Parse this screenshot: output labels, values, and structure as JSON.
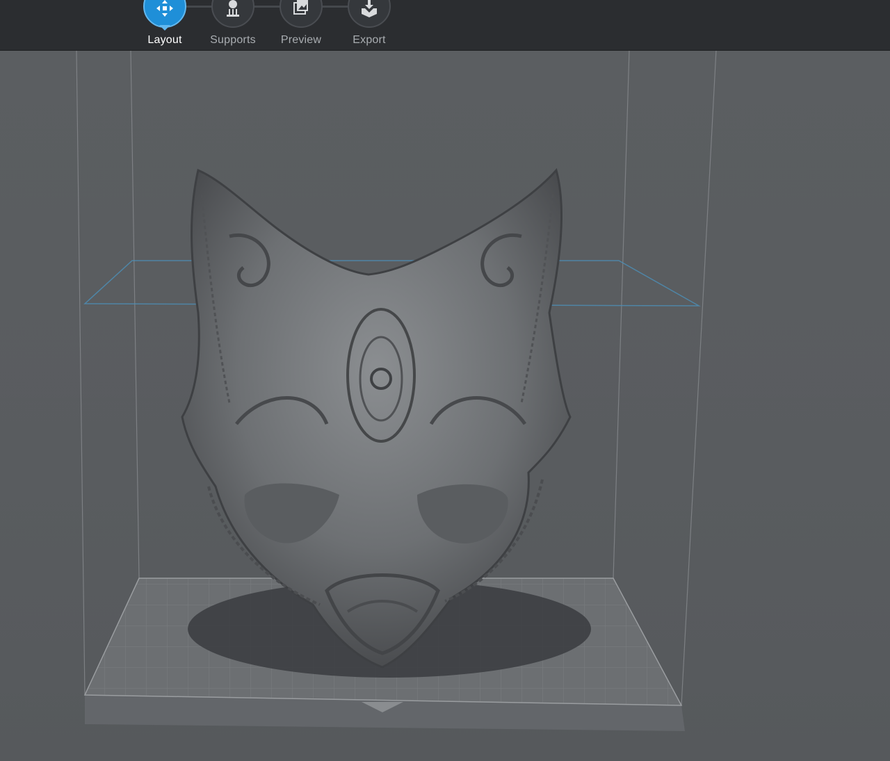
{
  "toolbar": {
    "steps": [
      {
        "label": "Layout",
        "icon": "layout-arrows-icon",
        "active": true
      },
      {
        "label": "Supports",
        "icon": "supports-icon",
        "active": false
      },
      {
        "label": "Preview",
        "icon": "preview-layers-icon",
        "active": false
      },
      {
        "label": "Export",
        "icon": "export-tray-icon",
        "active": false
      }
    ],
    "active_color": "#1f8fd8"
  },
  "viewport": {
    "object": "ornate-cat-mask-model",
    "background_color": "#5a5d60",
    "build_plate_grid": true
  }
}
